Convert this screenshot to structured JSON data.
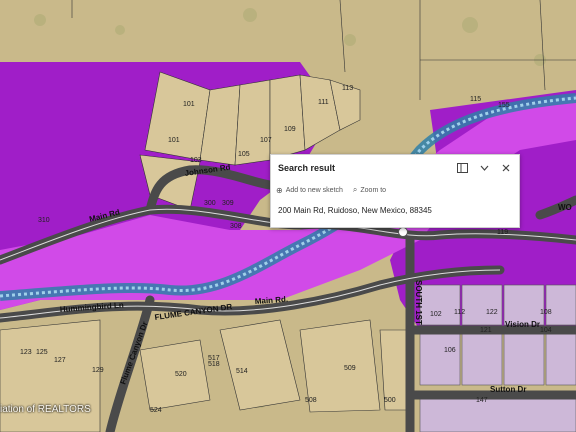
{
  "map": {
    "roads": [
      "Main Rd",
      "Johnson Rd",
      "Hummingbird Ln",
      "FLUME CANYON DR",
      "Flume Canyon Dr",
      "SOUTH 1ST",
      "Vision Dr",
      "Sutton Dr",
      "Main Rd.",
      "WO"
    ],
    "parcels": [
      "101",
      "101",
      "103",
      "105",
      "107",
      "109",
      "111",
      "113",
      "115",
      "310",
      "300",
      "309",
      "308",
      "119",
      "517",
      "518",
      "520",
      "524",
      "509",
      "508",
      "500",
      "514",
      "123",
      "125",
      "127",
      "129",
      "112",
      "122",
      "121",
      "108",
      "104",
      "102",
      "106",
      "147",
      "155"
    ],
    "attribution": "iation of REALTORS"
  },
  "popup": {
    "title": "Search result",
    "actions": [
      {
        "icon": "add-to-sketch-icon",
        "label": "Add to new sketch"
      },
      {
        "icon": "zoom-to-icon",
        "label": "Zoom to"
      }
    ],
    "address": "200 Main Rd, Ruidoso, New Mexico, 88345",
    "icons": {
      "dock": "dock-icon",
      "collapse": "chevron-down-icon",
      "close": "close-icon"
    }
  },
  "colors": {
    "terrain": "#c9b98a",
    "flood_zone": "#a01ec8",
    "flood_zone_light": "#d14ae8",
    "road": "#4a4a4a",
    "water": "#2f7fa8",
    "parcel_tan": "#d8c79a",
    "parcel_lavender": "#cdb8d8"
  }
}
